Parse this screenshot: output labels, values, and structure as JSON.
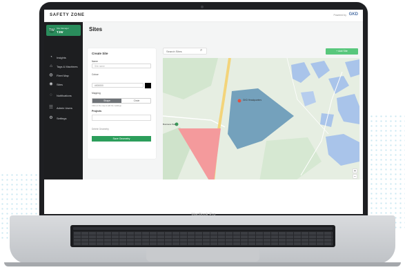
{
  "device": {
    "label": "MacBook Pro"
  },
  "app": {
    "logo": "SAFETY ZONE",
    "powered_by": "Powered by",
    "brand": "GKD",
    "accent": "#2c9e5b"
  },
  "user": {
    "role": "Site Manager",
    "initials": "TW",
    "name": "TJW"
  },
  "nav": [
    {
      "label": "Insights",
      "icon": "chart-icon"
    },
    {
      "label": "Tags & Machines",
      "icon": "tag-icon"
    },
    {
      "label": "Fleet Map",
      "icon": "globe-icon"
    },
    {
      "label": "Sites",
      "icon": "location-icon"
    },
    {
      "label": "Notifications",
      "icon": "bell-icon"
    },
    {
      "label": "Admin Users",
      "icon": "users-icon"
    },
    {
      "label": "Settings",
      "icon": "gear-icon"
    }
  ],
  "page": {
    "title": "Sites"
  },
  "form": {
    "title": "Create Site",
    "name_label": "Name",
    "name_placeholder": "Site name",
    "colour_label": "Colour",
    "colour_value": "#000000",
    "mapping_label": "Mapping",
    "mapping_options": [
      "Shape",
      "Circle"
    ],
    "mapping_hint": "Click on the map to add the markings",
    "projects_label": "Projects",
    "delete_label": "Delete Geometry",
    "save_label": "Save Geometry"
  },
  "search": {
    "placeholder": "Search Sites"
  },
  "add_site": {
    "label": "+ Add Site"
  },
  "map": {
    "marker_label": "GKD Headquarters",
    "marker_left_label": "Business Park",
    "zoom_in": "+",
    "zoom_out": "−",
    "zone_pink_color": "#f49a9c",
    "zone_blue_color": "#5f93b5"
  }
}
